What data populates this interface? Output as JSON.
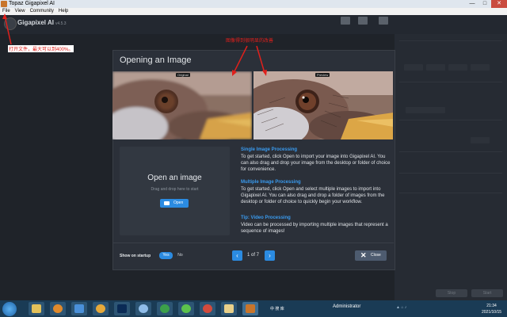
{
  "window": {
    "title": "Topaz Gigapixel AI",
    "minimize": "—",
    "maximize": "□",
    "close": "✕"
  },
  "menu": [
    "File",
    "View",
    "Community",
    "Help"
  ],
  "app": {
    "name": "Gigapixel AI",
    "version": "v4.5.3"
  },
  "annotations": {
    "left": "打开文件，最大可以到400%。",
    "top": "图像得到很明显的改善"
  },
  "modal": {
    "title": "Opening an Image",
    "compare": {
      "left_tag": "Original",
      "right_tag": "Preview"
    },
    "dropzone": {
      "title": "Open an image",
      "subtitle": "Drag and drop here to start",
      "button": "Open"
    },
    "sections": [
      {
        "heading": "Single Image Processing",
        "body": "To get started, click Open to import your image into Gigapixel AI. You can also drag and drop your image from the desktop or folder of choice for convenience."
      },
      {
        "heading": "Multiple Image Processing",
        "body": "To get started, click Open and select multiple images to import into Gigapixel AI. You can also drag and drop a folder of images from the desktop or folder of choice to quickly begin your workflow."
      },
      {
        "heading": "Tip: Video Processing",
        "body": "Video can be processed by importing multiple images that represent a sequence of images!"
      }
    ],
    "footer": {
      "show_on_startup": "Show on startup",
      "yes": "Yes",
      "no": "No",
      "prev": "‹",
      "next": "›",
      "page": "1 of 7",
      "close": "Close"
    }
  },
  "right_panel": {
    "stop": "Stop",
    "start": "Start"
  },
  "taskbar": {
    "lang": "中 搜 库",
    "user": "Administrator",
    "time": "21:34",
    "date": "2021/10/15"
  },
  "colors": {
    "accent": "#2b8be1",
    "annotation": "#e0201c",
    "background": "#1f2329",
    "modal": "#2b3039"
  }
}
